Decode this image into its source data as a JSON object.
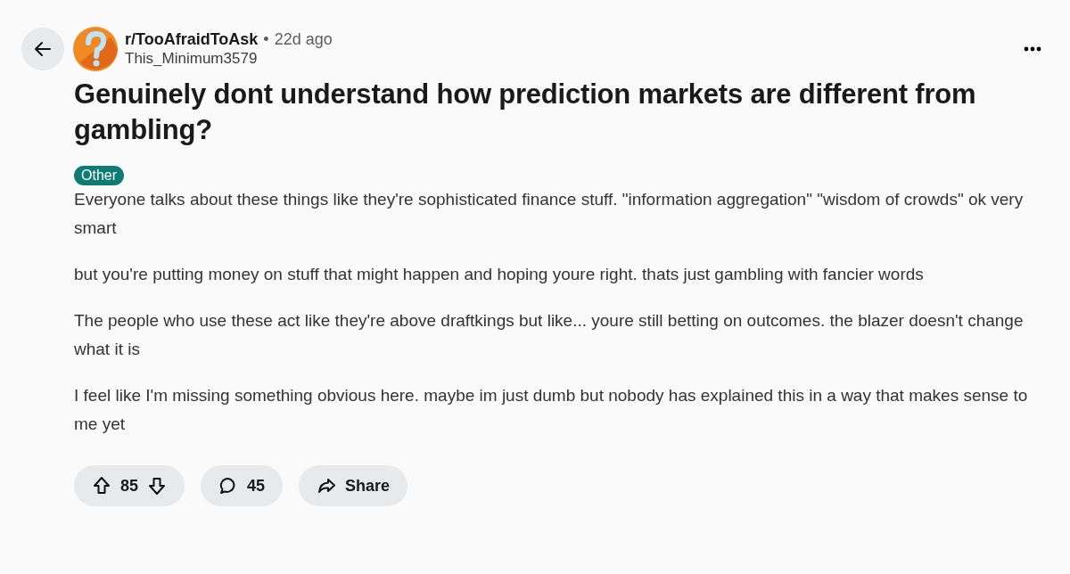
{
  "post": {
    "subreddit": "r/TooAfraidToAsk",
    "separator": "•",
    "time": "22d ago",
    "author": "This_Minimum3579",
    "title": "Genuinely dont understand how prediction markets are different from gambling?",
    "flair": {
      "label": "Other",
      "color": "#0f7b74"
    },
    "paragraphs": [
      "Everyone talks about these things like they're sophisticated finance stuff. \"information aggregation\" \"wisdom of crowds\" ok very smart",
      "but you're putting money on stuff that might happen and hoping youre right. thats just gambling with fancier words",
      "The people who use these act like they're above draftkings but like... youre still betting on outcomes. the blazer doesn't change what it is",
      "I feel like I'm missing something obvious here. maybe im just dumb but nobody has explained this in a way that makes sense to me yet"
    ]
  },
  "actions": {
    "votes": "85",
    "comments": "45",
    "share": "Share"
  }
}
